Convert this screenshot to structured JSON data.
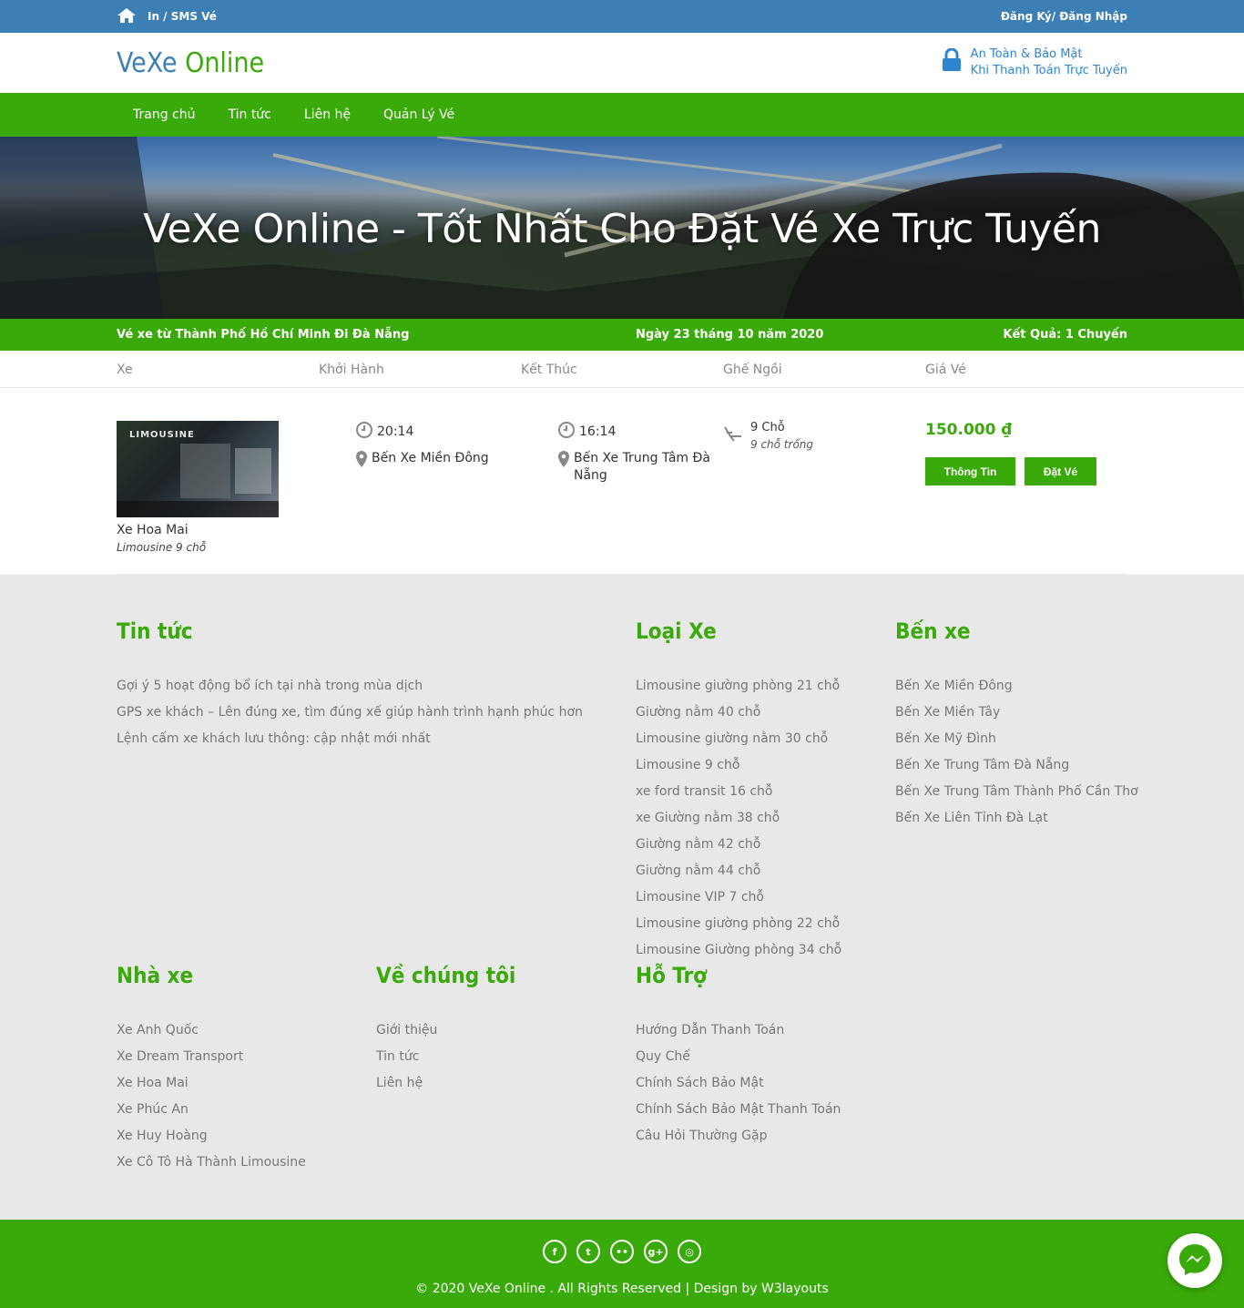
{
  "topbar": {
    "home_link": "In / SMS Vé",
    "auth_link": "Đăng Ký/ Đăng Nhập"
  },
  "header": {
    "logo_part1": "VeXe",
    "logo_part2": "Online",
    "secure_line1": "An Toàn & Bảo Mật",
    "secure_line2": "Khi Thanh Toán Trực Tuyến"
  },
  "nav": {
    "items": [
      "Trang chủ",
      "Tin tức",
      "Liên hệ",
      "Quản Lý Vé"
    ]
  },
  "hero": {
    "title": "VeXe Online - Tốt Nhất Cho Đặt Vé Xe Trực Tuyến"
  },
  "result": {
    "route": "Vé xe từ Thành Phố Hồ Chí Minh Đi Đà Nẵng",
    "date": "Ngày 23 tháng 10 năm 2020",
    "count": "Kết Quả: 1 Chuyến"
  },
  "table": {
    "headers": [
      "Xe",
      "Khởi Hành",
      "Kết Thúc",
      "Ghế Ngồi",
      "Giá Vé"
    ],
    "trip": {
      "image_tag": "LIMOUSINE",
      "bus_name": "Xe Hoa Mai",
      "bus_type": "Limousine 9 chỗ",
      "depart_time": "20:14",
      "depart_place": "Bến Xe Miền Đông",
      "arrive_time": "16:14",
      "arrive_place": "Bến Xe Trung Tâm Đà Nẵng",
      "seats": "9 Chỗ",
      "seats_free": "9 chỗ trống",
      "price": "150.000 ₫",
      "info_button": "Thông Tin",
      "book_button": "Đặt Vé"
    }
  },
  "footer": {
    "news": {
      "title": "Tin tức",
      "items": [
        "Gợi ý 5 hoạt động bổ ích tại nhà trong mùa dịch",
        "GPS xe khách – Lên đúng xe, tìm đúng xế giúp hành trình hạnh phúc hơn",
        "Lệnh cấm xe khách lưu thông: cập nhật mới nhất"
      ]
    },
    "types": {
      "title": "Loại Xe",
      "items": [
        "Limousine giường phòng 21 chỗ",
        "Giường nằm 40 chỗ",
        "Limousine giường nằm 30 chỗ",
        "Limousine 9 chỗ",
        "xe ford transit 16 chỗ",
        "xe Giường nằm 38 chỗ",
        "Giường nằm 42 chỗ",
        "Giường nằm 44 chỗ",
        "Limousine VIP 7 chỗ",
        "Limousine giường phòng 22 chỗ",
        "Limousine Giường phòng 34 chỗ"
      ]
    },
    "stations": {
      "title": "Bến xe",
      "items": [
        "Bến Xe Miền Đông",
        "Bến Xe Miền Tây",
        "Bến Xe Mỹ Đình",
        "Bến Xe Trung Tâm Đà Nẵng",
        "Bến Xe Trung Tâm Thành Phố Cần Thơ",
        "Bến Xe Liên Tỉnh Đà Lạt"
      ]
    },
    "operators": {
      "title": "Nhà xe",
      "items": [
        "Xe Anh Quốc",
        "Xe Dream Transport",
        "Xe Hoa Mai",
        "Xe Phúc An",
        "Xe Huy Hoàng",
        "Xe Cô Tô Hà Thành Limousine"
      ]
    },
    "about": {
      "title": "Về chúng tôi",
      "items": [
        "Giới thiệu",
        "Tin tức",
        "Liên hệ"
      ]
    },
    "support": {
      "title": "Hỗ Trợ",
      "items": [
        "Hướng Dẫn Thanh Toán",
        "Quy Chế",
        "Chính Sách Bảo Mật",
        "Chính Sách Bảo Mật Thanh Toán",
        "Câu Hỏi Thường Gặp"
      ]
    },
    "copyright": "© 2020 VeXe Online . All Rights Reserved | Design by W3layouts",
    "social_icons": [
      "facebook-icon",
      "twitter-icon",
      "flickr-icon",
      "google-plus-icon",
      "dribbble-icon"
    ]
  },
  "colors": {
    "primary_green": "#3aaa0a",
    "top_blue": "#3b7fb5",
    "footer_bg": "#e8e8e8"
  }
}
